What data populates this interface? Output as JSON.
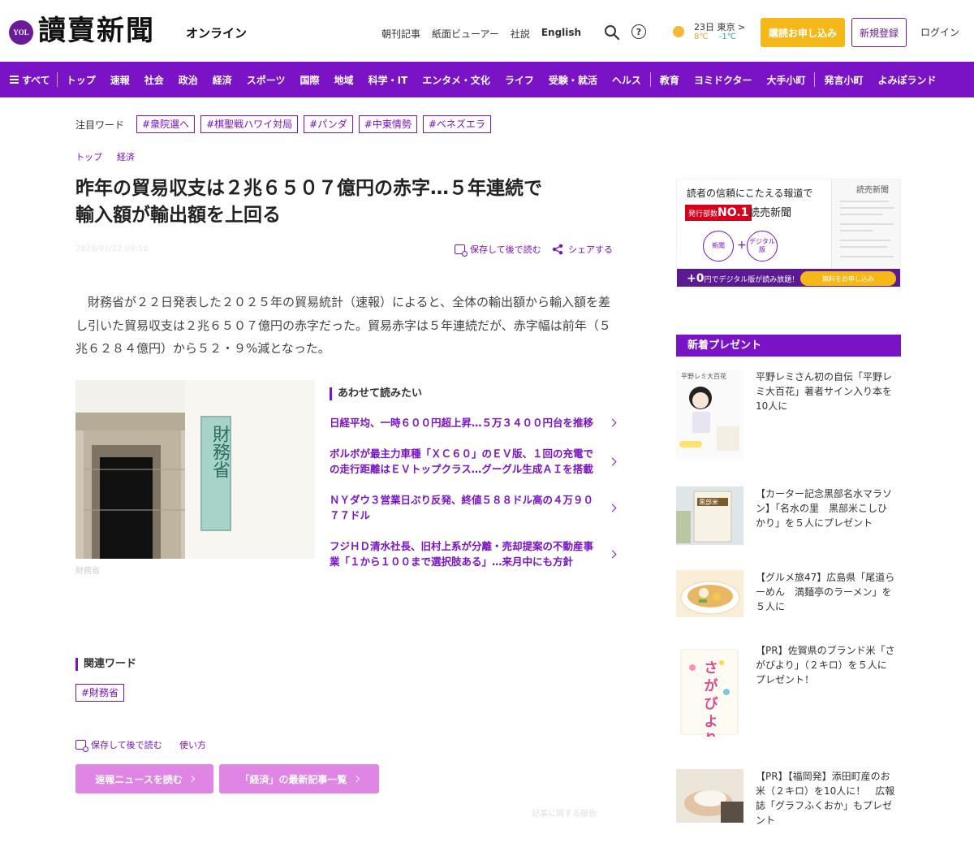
{
  "header": {
    "logo_badge": "YOL",
    "logo": "讀賣新聞",
    "logo_sub": "オンライン",
    "links": [
      "朝刊記事",
      "紙面ビューアー",
      "社説",
      "English"
    ],
    "help_symbol": "?",
    "weather": {
      "city": "23日 東京 >",
      "high": "8℃",
      "low": "-1℃"
    },
    "subscribe": "購読お申し込み",
    "register": "新規登録",
    "login": "ログイン"
  },
  "nav": {
    "menu_label": "すべて",
    "items": [
      "トップ",
      "速報",
      "社会",
      "政治",
      "経済",
      "スポーツ",
      "国際",
      "地域",
      "科学・IT",
      "エンタメ・文化",
      "ライフ",
      "受験・就活",
      "ヘルス",
      "教育",
      "ヨミドクター",
      "大手小町",
      "発言小町",
      "よみぽランド"
    ]
  },
  "topics": {
    "label": "注目ワード",
    "tags": [
      "#衆院選へ",
      "#棋聖戦ハワイ対局",
      "#パンダ",
      "#中東情勢",
      "#ベネズエラ"
    ]
  },
  "breadcrumb": [
    "トップ",
    "経済"
  ],
  "article": {
    "headline_line1": "昨年の貿易収支は２兆６５０７億円の赤字…５年連続で",
    "headline_line2": "輸入額が輸出額を上回る",
    "date": "2026/01/22 09:10",
    "save_label": "保存して後で読む",
    "share_label": "シェアする",
    "body": "財務省が２２日発表した２０２５年の貿易統計（速報）によると、全体の輸出額から輸入額を差し引いた貿易収支は２兆６５０７億円の赤字だった。貿易赤字は５年連続だが、赤字幅は前年（５兆６２８４億円）から５２・９%減となった。",
    "photo_caption": "財務省",
    "photo_sign": "財務省"
  },
  "related": {
    "title": "あわせて読みたい",
    "items": [
      "日経平均、一時６００円超上昇…５万３４００円台を推移",
      "ボルボが最主力車種「ＸＣ６０」のＥＶ版、１回の充電での走行距離はＥＶトップクラス…グーグル生成ＡＩを搭載",
      "ＮＹダウ３営業日ぶり反発、終値５８８ドル高の４万９０７７ドル",
      "フジＨＤ清水社長、旧村上系が分離・売却提案の不動産事業「１から１００まで選択肢ある」…来月中にも方針"
    ]
  },
  "keywords": {
    "title": "関連ワード",
    "tag": "#財務省"
  },
  "footer_actions": {
    "save_label": "保存して後で読む",
    "usage": "使い方",
    "btn_news": "速報ニュースを読む",
    "btn_latest": "「経済」の最新記事一覧",
    "faint": "記事に関する報告"
  },
  "ad": {
    "line1": "読者の信頼にこたえる報道で",
    "badge_prefix": "発行部数",
    "badge_no1": "NO.1",
    "brand": "読売新聞",
    "circle1": "新聞",
    "plus": "+",
    "circle2": "デジタル版",
    "paper_title": "読売新聞",
    "bar_text_big": "+0",
    "bar_text": "円でデジタル版が読み放題！",
    "bar_btn": "無料をお申し込み"
  },
  "gifts": {
    "title": "新着プレゼント",
    "items": [
      {
        "text": "平野レミさん初の自伝「平野レミ大百花」著者サイン入り本を10人に",
        "thumb_label": "平野レミ大百花"
      },
      {
        "text": "【カーター記念黒部名水マラソン】「名水の里　黒部米こしひかり」を５人にプレゼント",
        "thumb_label": "黒部米"
      },
      {
        "text": "【グルメ旅47】広島県「尾道らーめん　満麺亭のラーメン」を５人に",
        "thumb_label": ""
      },
      {
        "text": "【PR】佐賀県のブランド米「さがびより」（２キロ）を５人にプレゼント！",
        "thumb_label": "さがびより"
      },
      {
        "text": "【PR】【福岡発】添田町産のお米（２キロ）を10人に！　広報誌「グラフふくおか」もプレゼント",
        "thumb_label": ""
      }
    ]
  }
}
